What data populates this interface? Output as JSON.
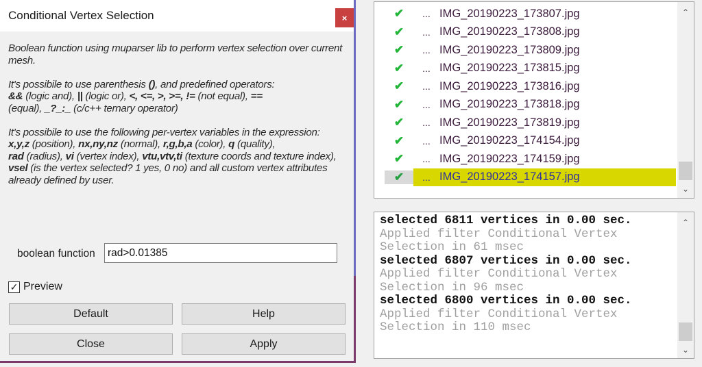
{
  "dialog": {
    "title": "Conditional Vertex Selection",
    "close_glyph": "×",
    "description": {
      "p1": "Boolean function using muparser lib to perform vertex selection over current mesh.",
      "p2_intro": "It's possibile to use parenthesis ",
      "p2_paren": "()",
      "p2_after": ", and predefined operators:",
      "p2_and": "&&",
      "p2_and_desc": " (logic and), ",
      "p2_or": "||",
      "p2_or_desc": " (logic or), ",
      "p2_ops": "<, <=, >, >=, !=",
      "p2_ne_desc": " (not equal), ",
      "p2_eq": "==",
      "p2_eq_desc": " (equal), ",
      "p2_tern": "_?_:_",
      "p2_tern_desc": " (c/c++ ternary operator)",
      "p3_intro": "It's possibile to use the following per-vertex variables in the expression:",
      "v_pos": "x,y,z",
      "v_pos_desc": " (position), ",
      "v_norm": "nx,ny,nz",
      "v_norm_desc": " (normal), ",
      "v_col": "r,g,b,a",
      "v_col_desc": " (color), ",
      "v_q": "q",
      "v_q_desc": " (quality), ",
      "v_rad": "rad",
      "v_rad_desc": " (radius), ",
      "v_vi": "vi",
      "v_vi_desc": " (vertex index), ",
      "v_tex": "vtu,vtv,ti",
      "v_tex_desc": " (texture coords and texture index), ",
      "v_sel": "vsel",
      "v_sel_desc": " (is the vertex selected? 1 yes, 0 no) and all custom vertex attributes already defined by user."
    },
    "function_label": "boolean function",
    "function_value": "rad>0.01385",
    "preview_label": "Preview",
    "preview_checked": true,
    "buttons": {
      "default": "Default",
      "help": "Help",
      "close": "Close",
      "apply": "Apply"
    }
  },
  "file_list": {
    "items": [
      {
        "status": "✔",
        "dots": "...",
        "name": "IMG_20190223_173807.jpg",
        "selected": false
      },
      {
        "status": "✔",
        "dots": "...",
        "name": "IMG_20190223_173808.jpg",
        "selected": false
      },
      {
        "status": "✔",
        "dots": "...",
        "name": "IMG_20190223_173809.jpg",
        "selected": false
      },
      {
        "status": "✔",
        "dots": "...",
        "name": "IMG_20190223_173815.jpg",
        "selected": false
      },
      {
        "status": "✔",
        "dots": "...",
        "name": "IMG_20190223_173816.jpg",
        "selected": false
      },
      {
        "status": "✔",
        "dots": "...",
        "name": "IMG_20190223_173818.jpg",
        "selected": false
      },
      {
        "status": "✔",
        "dots": "...",
        "name": "IMG_20190223_173819.jpg",
        "selected": false
      },
      {
        "status": "✔",
        "dots": "...",
        "name": "IMG_20190223_174154.jpg",
        "selected": false
      },
      {
        "status": "✔",
        "dots": "...",
        "name": "IMG_20190223_174159.jpg",
        "selected": false
      },
      {
        "status": "✔",
        "dots": "...",
        "name": "IMG_20190223_174157.jpg",
        "selected": true
      }
    ],
    "scroll_up": "⌃",
    "scroll_down": "⌄"
  },
  "log": {
    "lines": [
      {
        "text": "selected 6811 vertices in 0.00 sec.",
        "style": "strong"
      },
      {
        "text": "Applied filter Conditional Vertex",
        "style": "muted"
      },
      {
        "text": "Selection in 61 msec",
        "style": "muted"
      },
      {
        "text": "selected 6807 vertices in 0.00 sec.",
        "style": "strong"
      },
      {
        "text": "Applied filter Conditional Vertex",
        "style": "muted"
      },
      {
        "text": "Selection in 96 msec",
        "style": "muted"
      },
      {
        "text": "selected 6800 vertices in 0.00 sec.",
        "style": "strong"
      },
      {
        "text": "Applied filter Conditional Vertex",
        "style": "muted"
      },
      {
        "text": "Selection in 110 msec",
        "style": "muted"
      }
    ],
    "scroll_up": "⌃",
    "scroll_down": "⌄"
  },
  "colors": {
    "selection_highlight": "#d8d800",
    "check_green": "#22b53a",
    "close_button_red": "#c94040"
  }
}
